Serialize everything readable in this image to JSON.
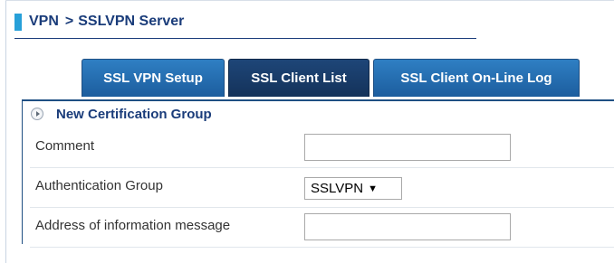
{
  "breadcrumb": {
    "root": "VPN",
    "separator": ">",
    "current": "SSLVPN Server"
  },
  "tabs": [
    {
      "label": "SSL VPN Setup",
      "active": false
    },
    {
      "label": "SSL Client List",
      "active": true
    },
    {
      "label": "SSL Client On-Line Log",
      "active": false
    }
  ],
  "section": {
    "title": "New Certification Group"
  },
  "fields": {
    "comment": {
      "label": "Comment",
      "value": ""
    },
    "auth_group": {
      "label": "Authentication Group",
      "value": "SSLVPN"
    },
    "address_info": {
      "label": "Address of information message",
      "value": ""
    }
  },
  "colors": {
    "accent_bar": "#27a0d9",
    "tab": "#2f7fc3",
    "tab_active": "#1e4678",
    "title_text": "#1a3c7a"
  }
}
